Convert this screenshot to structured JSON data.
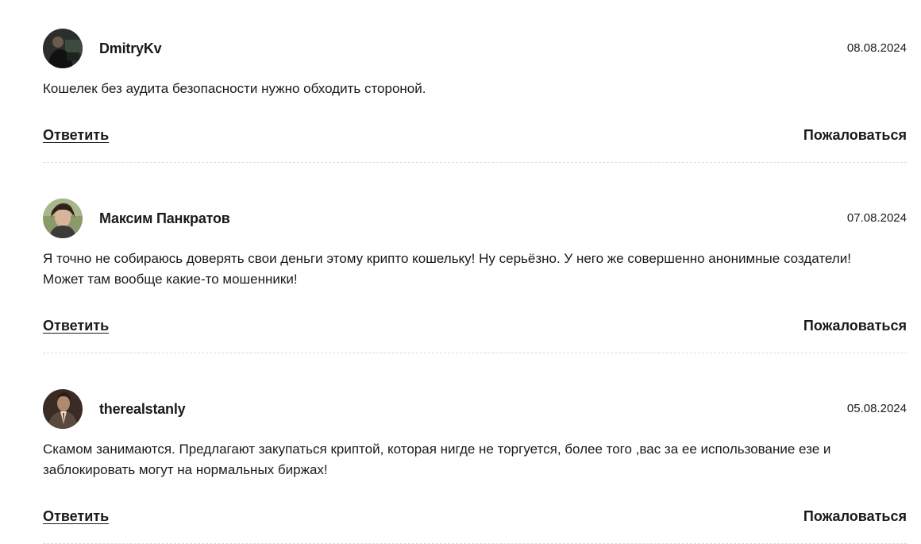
{
  "comments": [
    {
      "author": "DmitryKv",
      "date": "08.08.2024",
      "text": "Кошелек без аудита безопасности нужно обходить стороной.",
      "reply_label": "Ответить",
      "report_label": "Пожаловаться"
    },
    {
      "author": "Максим Панкратов",
      "date": "07.08.2024",
      "text": "Я точно не собираюсь доверять свои деньги этому крипто кошельку! Ну серьёзно. У него же совершенно анонимные создатели! Может там вообще какие-то мошенники!",
      "reply_label": "Ответить",
      "report_label": "Пожаловаться"
    },
    {
      "author": "therealstanly",
      "date": "05.08.2024",
      "text": "Скамом занимаются. Предлагают закупаться криптой, которая нигде не торгуется, более того ,вас за ее использование езе и заблокировать могут на нормальных биржах!",
      "reply_label": "Ответить",
      "report_label": "Пожаловаться"
    }
  ]
}
